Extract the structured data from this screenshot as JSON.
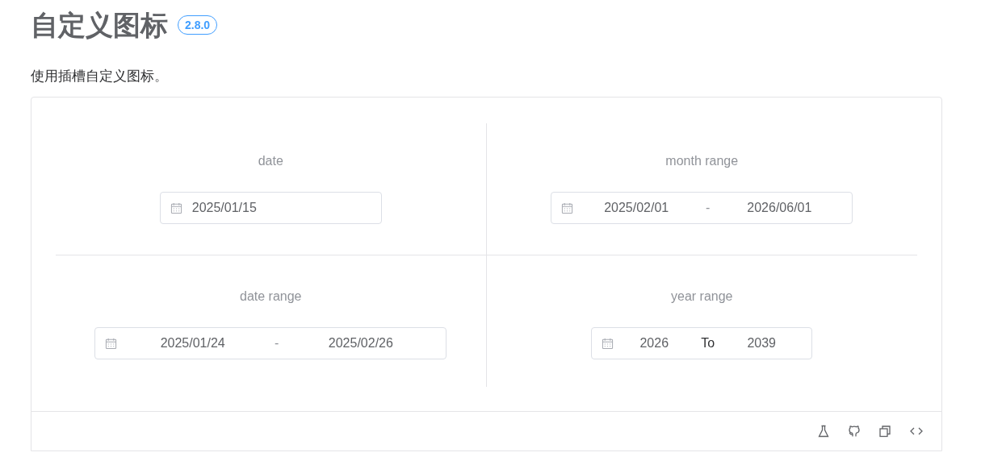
{
  "title": "自定义图标",
  "version": "2.8.0",
  "description": "使用插槽自定义图标。",
  "demos": [
    {
      "label": "date",
      "kind": "single",
      "values": [
        "2025/01/15"
      ]
    },
    {
      "label": "month range",
      "kind": "range",
      "values": [
        "2025/02/01",
        "2026/06/01"
      ],
      "separator": "-"
    },
    {
      "label": "date range",
      "kind": "range",
      "values": [
        "2025/01/24",
        "2025/02/26"
      ],
      "separator": "-"
    },
    {
      "label": "year range",
      "kind": "range",
      "values": [
        "2026",
        "2039"
      ],
      "separator": "To"
    }
  ]
}
